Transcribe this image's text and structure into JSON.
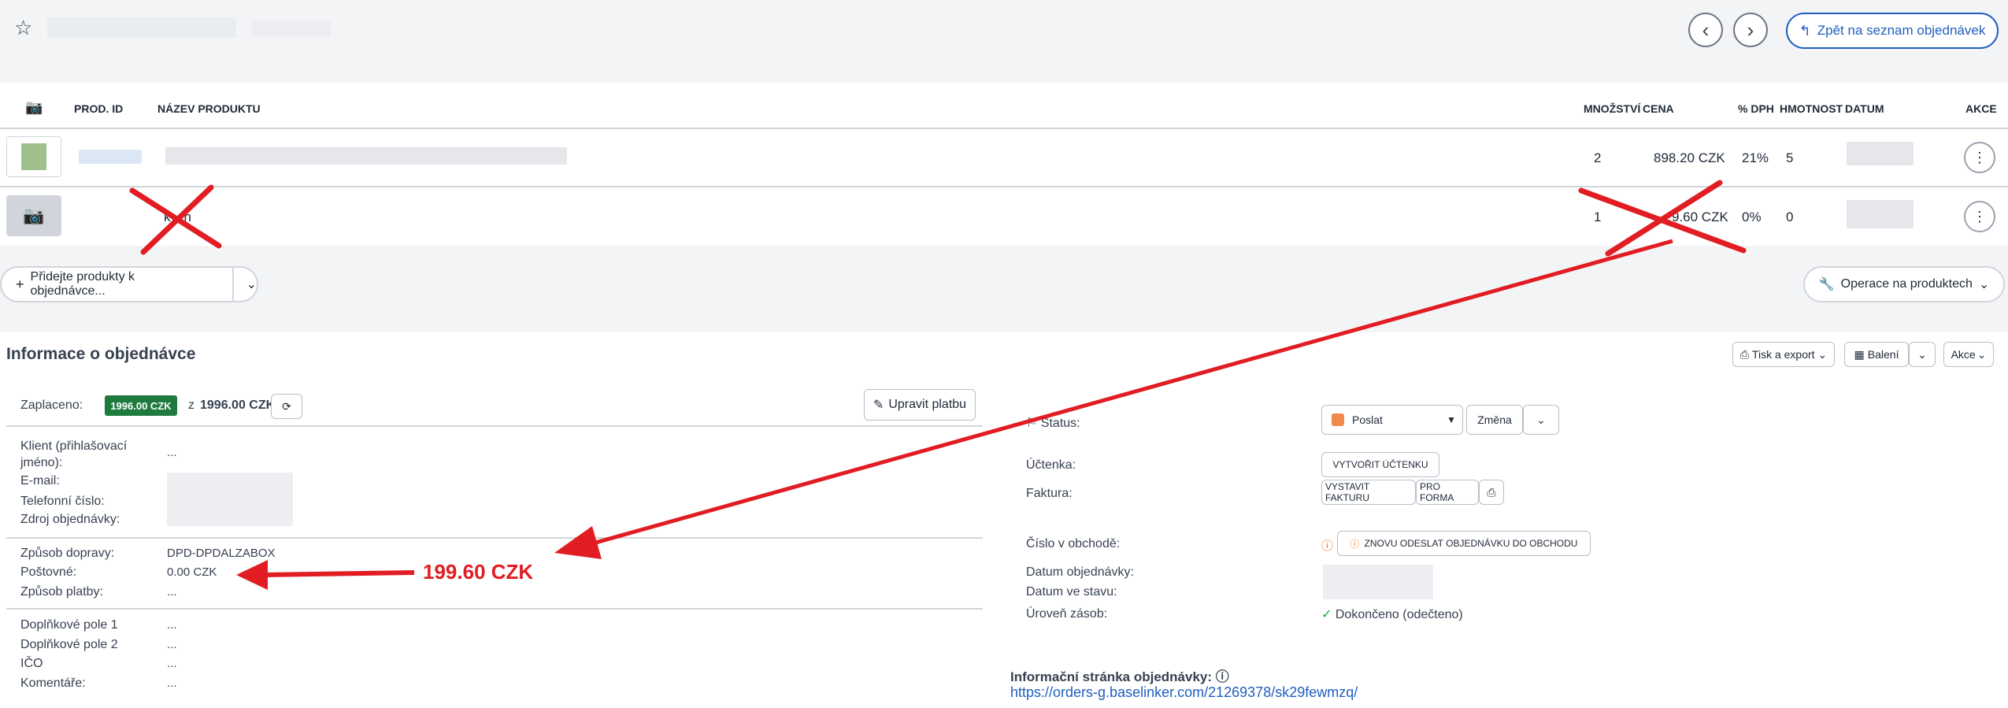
{
  "header": {
    "back_button_label": "Zpět na seznam objednávek"
  },
  "table": {
    "headers": {
      "prod_id": "PROD. ID",
      "name": "NÁZEV PRODUKTU",
      "qty": "MNOŽSTVÍ",
      "price": "CENA",
      "vat": "% DPH",
      "weight": "HMOTNOST",
      "date": "DATUM",
      "actions": "AKCE"
    },
    "rows": [
      {
        "qty": "2",
        "price": "898.20 CZK",
        "vat": "21%",
        "weight": "5"
      },
      {
        "name_partial": "k…n",
        "qty": "1",
        "price": "…9.60 CZK",
        "vat": "0%",
        "weight": "0"
      }
    ]
  },
  "toolbar": {
    "add_products_label": "Přidejte produkty k objednávce...",
    "product_ops_label": "Operace na produktech"
  },
  "order_info": {
    "title": "Informace o objednávce",
    "print_export_label": "Tisk a export",
    "packing_label": "Balení",
    "actions_label": "Akce",
    "paid_label": "Zaplaceno:",
    "paid_badge": "1996.00 CZK",
    "paid_of_prefix": "z",
    "paid_of_value": "1996.00 CZK",
    "edit_payment_label": "Upravit platbu",
    "client_label": "Klient (přihlašovací jméno):",
    "client_value": "...",
    "email_label": "E-mail:",
    "phone_label": "Telefonní číslo:",
    "source_label": "Zdroj objednávky:",
    "shipping_method_label": "Způsob dopravy:",
    "shipping_method_value": "DPD-DPDALZABOX",
    "postage_label": "Poštovné:",
    "postage_value": "0.00 CZK",
    "payment_method_label": "Způsob platby:",
    "payment_method_value": "...",
    "extra1_label": "Doplňkové pole 1",
    "extra1_value": "...",
    "extra2_label": "Doplňkové pole 2",
    "extra2_value": "...",
    "ico_label": "IČO",
    "ico_value": "...",
    "comments_label": "Komentáře:",
    "comments_value": "..."
  },
  "annotation": {
    "amount_label": "199.60 CZK"
  },
  "right_info": {
    "status_label": "Status:",
    "status_value": "Poslat",
    "change_label": "Změna",
    "receipt_label": "Účtenka:",
    "create_receipt_label": "VYTVOŘIT ÚČTENKU",
    "invoice_label": "Faktura:",
    "issue_invoice_label": "VYSTAVIT FAKTURU",
    "pro_forma_label": "PRO FORMA",
    "shop_number_label": "Číslo v obchodě:",
    "resend_label": "ZNOVU ODESLAT OBJEDNÁVKU DO OBCHODU",
    "order_date_label": "Datum objednávky:",
    "status_date_label": "Datum ve stavu:",
    "stock_level_label": "Úroveň zásob:",
    "stock_level_value": "Dokončeno (odečteno)",
    "info_page_label": "Informační stránka objednávky:",
    "info_page_url": "https://orders-g.baselinker.com/21269378/sk29fewmzq/"
  },
  "colors": {
    "accent": "#1f5fbf",
    "paid_green": "#1f7a3f",
    "status_orange": "#f08a4b",
    "annotation_red": "#e11d23"
  }
}
